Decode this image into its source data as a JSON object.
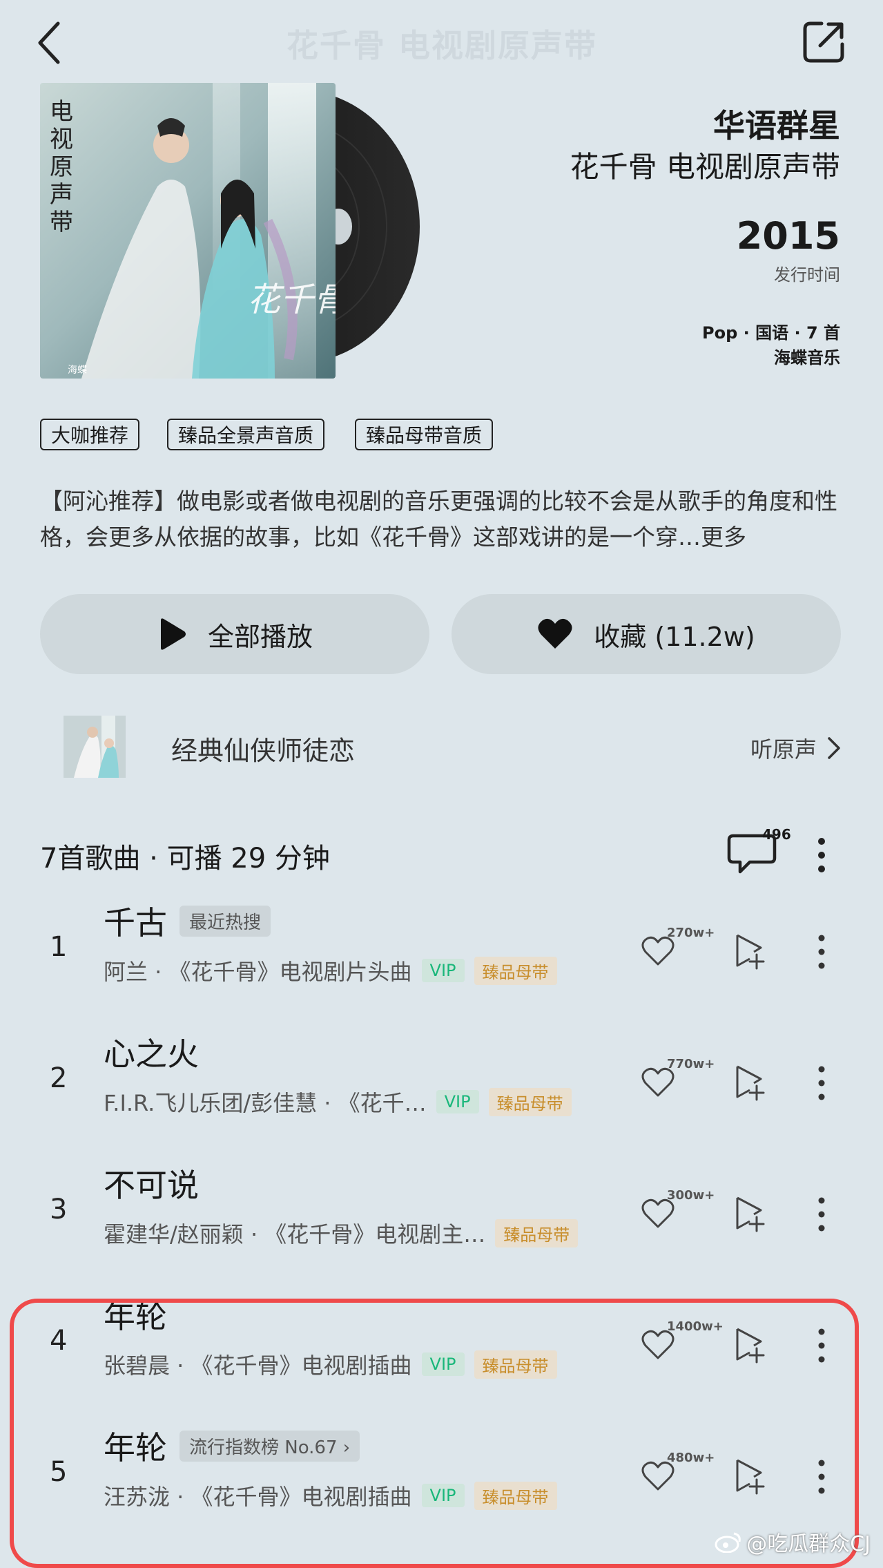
{
  "header": {
    "ghost_title": "花千骨 电视剧原声带"
  },
  "album": {
    "cover_text": "电视原声带",
    "cover_small": "海蝶",
    "artist": "华语群星",
    "name": "花千骨 电视剧原声带",
    "year": "2015",
    "release_label": "发行时间",
    "meta": "Pop · 国语 · 7 首",
    "label": "海蝶音乐"
  },
  "tags": [
    "大咖推荐",
    "臻品全景声音质",
    "臻品母带音质"
  ],
  "description": {
    "text": "【阿沁推荐】做电影或者做电视剧的音乐更强调的比较不会是从歌手的角度和性格，会更多从依据的故事，比如《花千骨》这部戏讲的是一个穿…",
    "more": "更多"
  },
  "actions": {
    "play_all": "全部播放",
    "collect": "收藏 (11.2w)"
  },
  "soundtrack": {
    "text": "经典仙侠师徒恋",
    "link": "听原声"
  },
  "list": {
    "summary": "7首歌曲 · 可播 29 分钟",
    "comment_count": "496"
  },
  "songs": [
    {
      "num": "1",
      "title": "千古",
      "badge": "最近热搜",
      "sub": "阿兰 · 《花千骨》电视剧片头曲",
      "vip": "VIP",
      "hq": "臻品母带",
      "likes": "270w+"
    },
    {
      "num": "2",
      "title": "心之火",
      "badge": "",
      "sub": "F.I.R.飞儿乐团/彭佳慧 · 《花千…",
      "vip": "VIP",
      "hq": "臻品母带",
      "likes": "770w+"
    },
    {
      "num": "3",
      "title": "不可说",
      "badge": "",
      "sub": "霍建华/赵丽颖 · 《花千骨》电视剧主…",
      "vip": "",
      "hq": "臻品母带",
      "likes": "300w+"
    },
    {
      "num": "4",
      "title": "年轮",
      "badge": "",
      "sub": "张碧晨 · 《花千骨》电视剧插曲",
      "vip": "VIP",
      "hq": "臻品母带",
      "likes": "1400w+"
    },
    {
      "num": "5",
      "title": "年轮",
      "badge": "流行指数榜 No.67 ›",
      "sub": "汪苏泷 · 《花千骨》电视剧插曲",
      "vip": "VIP",
      "hq": "臻品母带",
      "likes": "480w+"
    }
  ],
  "watermark": "@吃瓜群众CJ",
  "icons": {
    "back": "chevron-left-icon",
    "share": "share-icon",
    "play": "play-icon",
    "heart": "heart-icon",
    "comment": "comment-icon",
    "more": "more-vertical-icon",
    "add": "add-to-playlist-icon",
    "chevron": "chevron-right-icon"
  },
  "colors": {
    "background": "#dde6eb",
    "vip": "#19b77a",
    "hq": "#c88e2c",
    "highlight": "#ef4a4a"
  }
}
